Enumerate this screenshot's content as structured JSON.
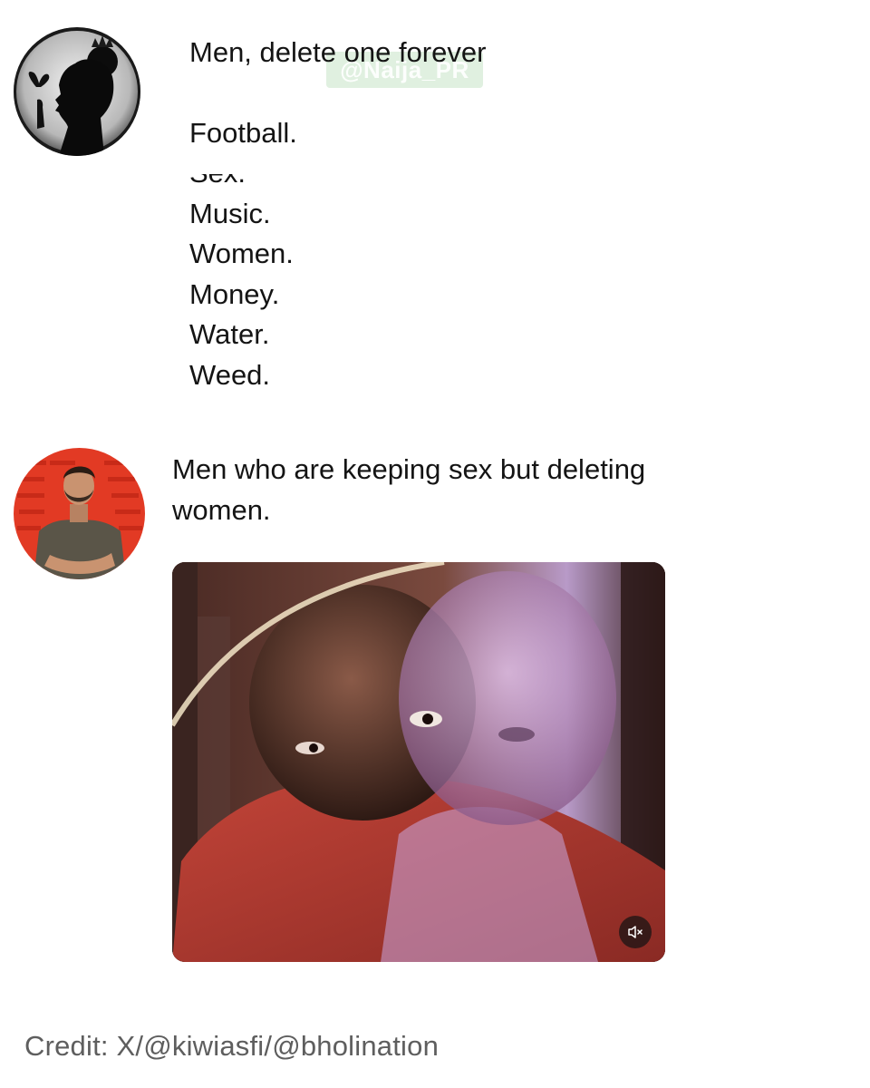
{
  "post1": {
    "text_line_1": "Men, delete one forever",
    "options": [
      "Football.",
      "Sex.",
      "Music.",
      "Women.",
      "Money.",
      "Water.",
      "Weed."
    ]
  },
  "watermark": "@Naija_PR",
  "post2": {
    "text": "Men who are keeping sex but deleting women."
  },
  "video": {
    "mute_icon": "speaker-muted-icon"
  },
  "credit": "Credit: X/@kiwiasfi/@bholination",
  "colors": {
    "avatar2_bg": "#e23a24",
    "credit_text": "#5e5e5e",
    "watermark_bg": "#90c890"
  }
}
